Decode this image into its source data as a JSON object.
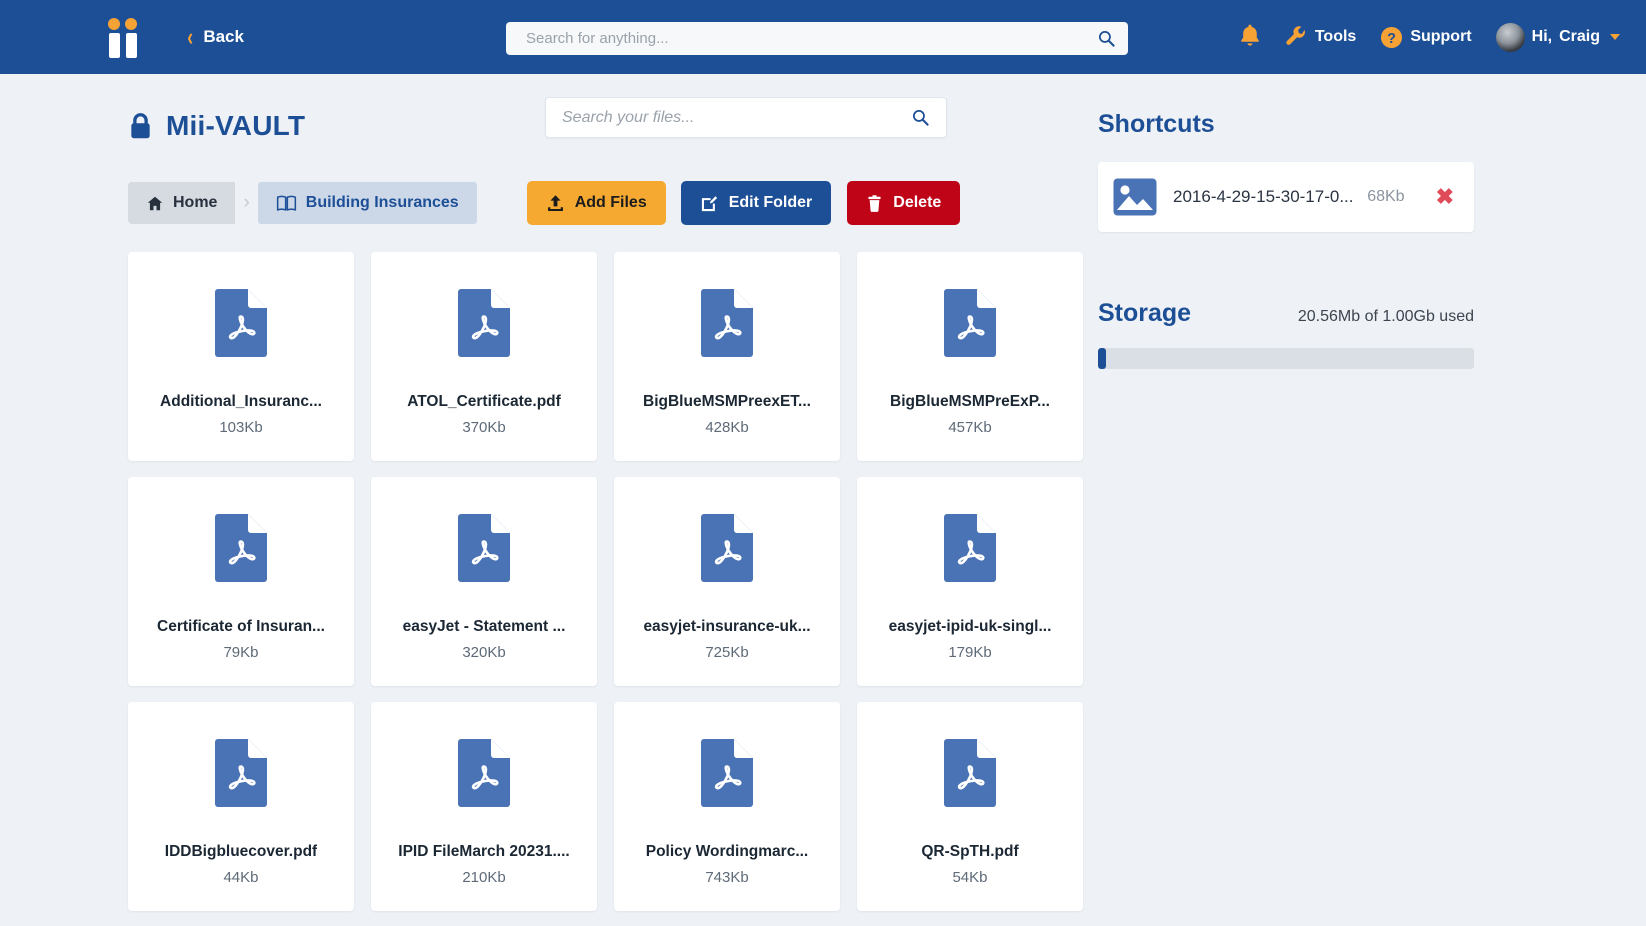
{
  "header": {
    "logo_name": "mii-logo",
    "back_label": "Back",
    "search": {
      "value": "",
      "placeholder": "Search for anything..."
    },
    "notifications_icon": "bell-icon",
    "tools_label": "Tools",
    "support_label": "Support",
    "greeting_prefix": "Hi,",
    "user_name": "Craig",
    "brand_blue": "#1d4f96",
    "brand_orange": "#f7a235"
  },
  "vault": {
    "title": "Mii-VAULT",
    "lock_icon": "lock-icon",
    "search": {
      "value": "",
      "placeholder": "Search your files..."
    }
  },
  "breadcrumb": {
    "home_label": "Home",
    "separator": "›",
    "current_label": "Building Insurances"
  },
  "actions": {
    "add_files_label": "Add Files",
    "edit_folder_label": "Edit Folder",
    "delete_label": "Delete",
    "add_color": "#f5a930",
    "edit_color": "#1d4f96",
    "delete_color": "#c00418"
  },
  "files": [
    {
      "name": "Additional_Insuranc...",
      "size": "103Kb",
      "type": "pdf"
    },
    {
      "name": "ATOL_Certificate.pdf",
      "size": "370Kb",
      "type": "pdf"
    },
    {
      "name": "BigBlueMSMPreexET...",
      "size": "428Kb",
      "type": "pdf"
    },
    {
      "name": "BigBlueMSMPreExP...",
      "size": "457Kb",
      "type": "pdf"
    },
    {
      "name": "Certificate of Insuran...",
      "size": "79Kb",
      "type": "pdf"
    },
    {
      "name": "easyJet - Statement ...",
      "size": "320Kb",
      "type": "pdf"
    },
    {
      "name": "easyjet-insurance-uk...",
      "size": "725Kb",
      "type": "pdf"
    },
    {
      "name": "easyjet-ipid-uk-singl...",
      "size": "179Kb",
      "type": "pdf"
    },
    {
      "name": "IDDBigbluecover.pdf",
      "size": "44Kb",
      "type": "pdf"
    },
    {
      "name": "IPID FileMarch 20231....",
      "size": "210Kb",
      "type": "pdf"
    },
    {
      "name": "Policy Wordingmarc...",
      "size": "743Kb",
      "type": "pdf"
    },
    {
      "name": "QR-SpTH.pdf",
      "size": "54Kb",
      "type": "pdf"
    }
  ],
  "sidebar": {
    "shortcuts_title": "Shortcuts",
    "shortcuts": [
      {
        "name": "2016-4-29-15-30-17-0...",
        "size": "68Kb",
        "icon": "image-icon",
        "remove_label": "✖"
      }
    ],
    "storage_title": "Storage",
    "storage_used_label": "20.56Mb of 1.00Gb used",
    "storage_percent": 2
  }
}
